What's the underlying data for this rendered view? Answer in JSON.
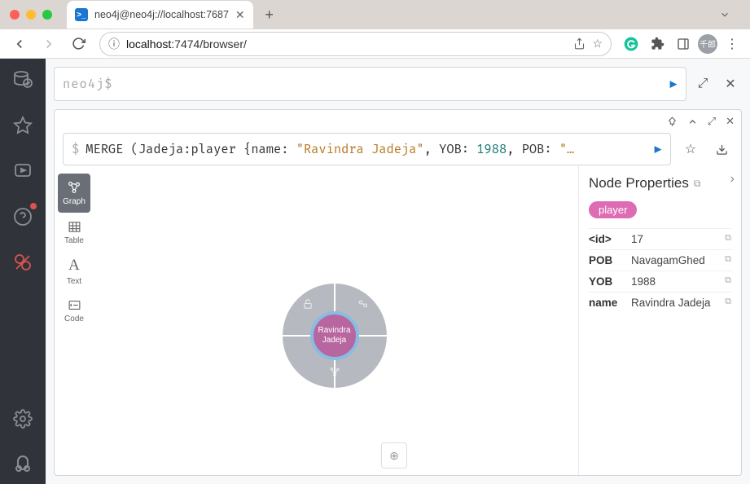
{
  "browser": {
    "tab_title": "neo4j@neo4j://localhost:7687",
    "url_host": "localhost",
    "url_path": ":7474/browser/",
    "avatar_text": "千郎"
  },
  "editor": {
    "prompt": "neo4j$"
  },
  "query": {
    "keyword": "MERGE",
    "pre": " (Jadeja:player {name: ",
    "str1": "\"Ravindra Jadeja\"",
    "mid1": ", YOB: ",
    "num1": "1988",
    "mid2": ", POB: ",
    "str2": "\"…"
  },
  "view_tabs": {
    "graph": "Graph",
    "table": "Table",
    "text": "Text",
    "code": "Code"
  },
  "node": {
    "label_line1": "Ravindra",
    "label_line2": "Jadeja"
  },
  "panel": {
    "title": "Node Properties",
    "badge": "player",
    "props": [
      {
        "k": "<id>",
        "v": "17"
      },
      {
        "k": "POB",
        "v": "NavagamGhed"
      },
      {
        "k": "YOB",
        "v": "1988"
      },
      {
        "k": "name",
        "v": "Ravindra Jadeja"
      }
    ]
  }
}
